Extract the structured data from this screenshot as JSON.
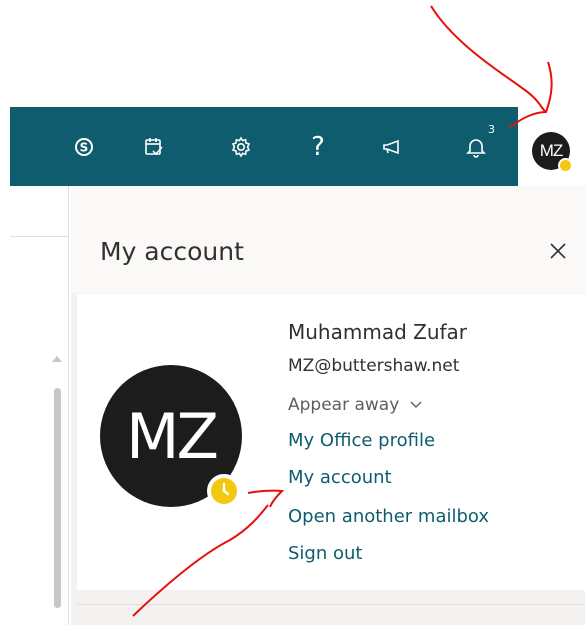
{
  "header": {
    "icons": [
      "skype-icon",
      "calendar-check-icon",
      "gear-icon",
      "help-icon",
      "megaphone-icon",
      "bell-icon"
    ],
    "help_label": "?",
    "notification_count": "3",
    "avatar_initials": "MZ"
  },
  "panel": {
    "title": "My account",
    "close_label": "×",
    "user": {
      "initials": "MZ",
      "name": "Muhammad Zufar",
      "email": "MZ@buttershaw.net",
      "status": "Appear away"
    },
    "links": {
      "office_profile": "My Office profile",
      "my_account": "My account",
      "open_mailbox": "Open another mailbox",
      "sign_out": "Sign out"
    }
  },
  "colors": {
    "header_bg": "#0e5c6e",
    "link": "#0e5c6e",
    "away": "#f2c811",
    "annotation": "#e8100a"
  }
}
